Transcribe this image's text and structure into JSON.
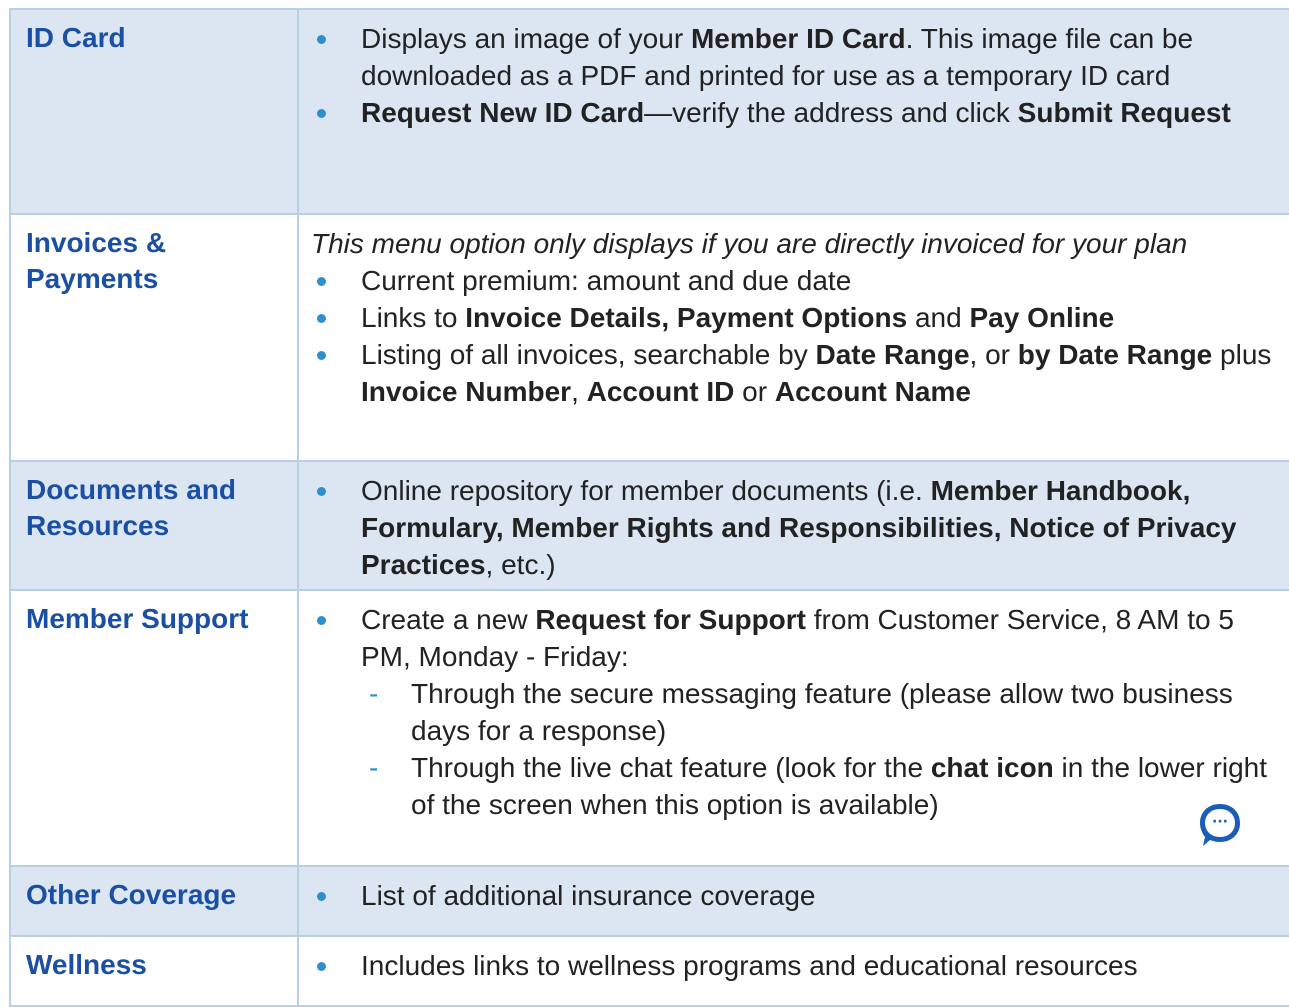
{
  "rows": [
    {
      "term": "ID Card",
      "shaded": true,
      "items": [
        {
          "before": "Displays an image of your ",
          "b1": "Member ID Card",
          "after": ". This image file can be downloaded as a PDF and printed for use as a temporary ID card"
        },
        {
          "b1": "Request New ID Card",
          "mid": "—verify the address and click ",
          "b2": "Submit Request"
        }
      ]
    },
    {
      "term": "Invoices & Payments",
      "shaded": false,
      "intro": "This menu option only displays if you are directly invoiced for your plan",
      "items": [
        {
          "text": "Current premium: amount and due date"
        },
        {
          "before": "Links to ",
          "b1": "Invoice Details, Payment Options",
          "mid": " and ",
          "b2": "Pay Online"
        },
        {
          "before": "Listing of all invoices, searchable by ",
          "b1": "Date Range",
          "mid1": ", or ",
          "b2": "by Date Range",
          "mid2": " plus ",
          "b3": "Invoice Number",
          "mid3": ", ",
          "b4": "Account ID",
          "mid4": " or ",
          "b5": "Account Name"
        }
      ]
    },
    {
      "term": "Documents and Resources",
      "shaded": true,
      "items": [
        {
          "before": "Online repository for member documents (i.e. ",
          "b1": "Member Handbook, Formulary, Member Rights and Responsibilities, Notice of Privacy Practices",
          "after": ", etc.)"
        }
      ]
    },
    {
      "term": "Member Support",
      "shaded": false,
      "items": [
        {
          "before": "Create a new ",
          "b1": "Request for Support",
          "after": " from Customer Service, 8 AM to 5 PM, Monday - Friday:",
          "subitems": [
            {
              "text": "Through the secure messaging feature (please allow two business days for a response)"
            },
            {
              "before": "Through the live chat feature (look for the ",
              "b1": "chat icon",
              "after": " in the lower right of the screen when this option is available)"
            }
          ]
        }
      ]
    },
    {
      "term": "Other Coverage",
      "shaded": true,
      "items": [
        {
          "text": "List of additional insurance coverage"
        }
      ]
    },
    {
      "term": "Wellness",
      "shaded": false,
      "items": [
        {
          "text": "Includes links to wellness programs and educational resources"
        }
      ]
    }
  ],
  "chat_icon": {
    "icon": "chat-bubble-icon",
    "color": "#1a5eb5",
    "glyph": "···"
  },
  "colors": {
    "term_text": "#1a4fa3",
    "bullet": "#2e8fcf",
    "shade": "#dce6f2",
    "border": "#b9cfe4"
  }
}
